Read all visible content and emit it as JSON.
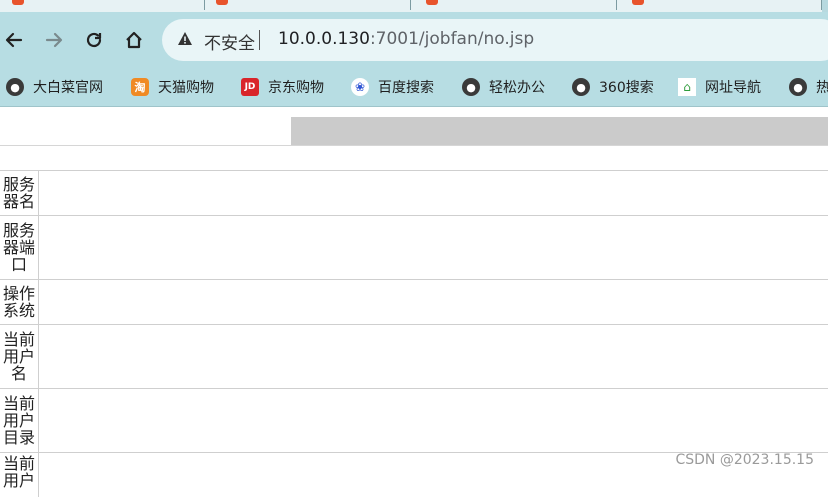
{
  "toolbar": {
    "insecure_label": "不安全",
    "url_host": "10.0.0.130",
    "url_rest": ":7001/jobfan/no.jsp"
  },
  "bookmarks": [
    {
      "label": "大白菜官网",
      "icon": "globe-icon"
    },
    {
      "label": "天猫购物",
      "icon": "tmall-icon"
    },
    {
      "label": "京东购物",
      "icon": "jd-icon"
    },
    {
      "label": "百度搜索",
      "icon": "baidu-icon"
    },
    {
      "label": "轻松办公",
      "icon": "globe-icon"
    },
    {
      "label": "360搜索",
      "icon": "globe-icon"
    },
    {
      "label": "网址导航",
      "icon": "2345-icon"
    },
    {
      "label": "热",
      "icon": "globe-icon"
    }
  ],
  "table": {
    "rows": [
      {
        "label": "服务器名",
        "value": ""
      },
      {
        "label": "服务器端口",
        "value": ""
      },
      {
        "label": "操作系统",
        "value": ""
      },
      {
        "label": "当前用户名",
        "value": ""
      },
      {
        "label": "当前用户目录",
        "value": ""
      },
      {
        "label": "当前用户",
        "value": ""
      }
    ]
  },
  "watermark": "CSDN @2023.15.15"
}
